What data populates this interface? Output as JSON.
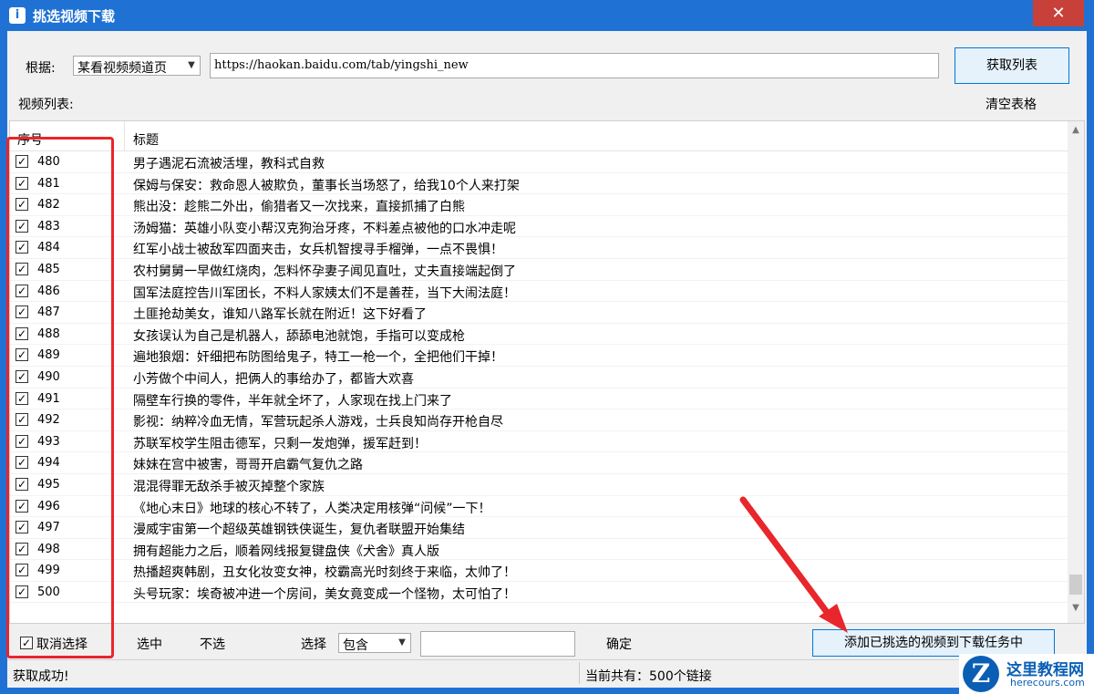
{
  "window": {
    "title": "挑选视频下载",
    "close_symbol": "✕",
    "icon_glyph": "i"
  },
  "toolbar": {
    "source_label": "根据:",
    "source_select_value": "某看视频频道页",
    "url_value": "https://haokan.baidu.com/tab/yingshi_new",
    "fetch_button": "获取列表"
  },
  "list_label": "视频列表:",
  "clear_table": "清空表格",
  "table": {
    "columns": [
      "序号",
      "标题"
    ],
    "rows": [
      {
        "idx": "480",
        "title": "男子遇泥石流被活埋，教科式自救"
      },
      {
        "idx": "481",
        "title": "保姆与保安：救命恩人被欺负，董事长当场怒了，给我10个人来打架"
      },
      {
        "idx": "482",
        "title": "熊出没：趁熊二外出，偷猎者又一次找来，直接抓捕了白熊"
      },
      {
        "idx": "483",
        "title": "汤姆猫：英雄小队变小帮汉克狗治牙疼，不料差点被他的口水冲走呢"
      },
      {
        "idx": "484",
        "title": "红军小战士被敌军四面夹击，女兵机智搜寻手榴弹，一点不畏惧！"
      },
      {
        "idx": "485",
        "title": "农村舅舅一早做红烧肉，怎料怀孕妻子闻见直吐，丈夫直接端起倒了"
      },
      {
        "idx": "486",
        "title": "国军法庭控告川军团长，不料人家姨太们不是善茬，当下大闹法庭！"
      },
      {
        "idx": "487",
        "title": "土匪抢劫美女，谁知八路军长就在附近！这下好看了"
      },
      {
        "idx": "488",
        "title": "女孩误认为自己是机器人，舔舔电池就饱，手指可以变成枪"
      },
      {
        "idx": "489",
        "title": "遍地狼烟：奸细把布防图给鬼子，特工一枪一个，全把他们干掉！"
      },
      {
        "idx": "490",
        "title": "小芳做个中间人，把俩人的事给办了，都皆大欢喜"
      },
      {
        "idx": "491",
        "title": "隔壁车行换的零件，半年就全坏了，人家现在找上门来了"
      },
      {
        "idx": "492",
        "title": "影视：纳粹冷血无情，军营玩起杀人游戏，士兵良知尚存开枪自尽"
      },
      {
        "idx": "493",
        "title": "苏联军校学生阻击德军，只剩一发炮弹，援军赶到！"
      },
      {
        "idx": "494",
        "title": "妹妹在宫中被害，哥哥开启霸气复仇之路"
      },
      {
        "idx": "495",
        "title": "混混得罪无敌杀手被灭掉整个家族"
      },
      {
        "idx": "496",
        "title": "《地心末日》地球的核心不转了，人类决定用核弹“问候”一下！"
      },
      {
        "idx": "497",
        "title": "漫威宇宙第一个超级英雄钢铁侠诞生，复仇者联盟开始集结"
      },
      {
        "idx": "498",
        "title": "拥有超能力之后，顺着网线报复键盘侠《犬舍》真人版"
      },
      {
        "idx": "499",
        "title": "热播超爽韩剧，丑女化妆变女神，校霸高光时刻终于来临，太帅了！"
      },
      {
        "idx": "500",
        "title": "头号玩家：埃奇被冲进一个房间，美女竟变成一个怪物，太可怕了！"
      }
    ]
  },
  "bottom": {
    "cancel_select": "取消选择",
    "select": "选中",
    "unselect": "不选",
    "choose_label": "选择",
    "match_select_value": "包含",
    "confirm": "确定",
    "add_button": "添加已挑选的视频到下载任务中"
  },
  "status": {
    "left": "获取成功!",
    "right": "当前共有：500个链接"
  },
  "watermark": {
    "logo_letter": "Z",
    "name": "这里教程网",
    "site": "herecours.com"
  },
  "colors": {
    "titlebar": "#1f72d4",
    "close": "#c7403a",
    "highlight": "#e8262b"
  }
}
